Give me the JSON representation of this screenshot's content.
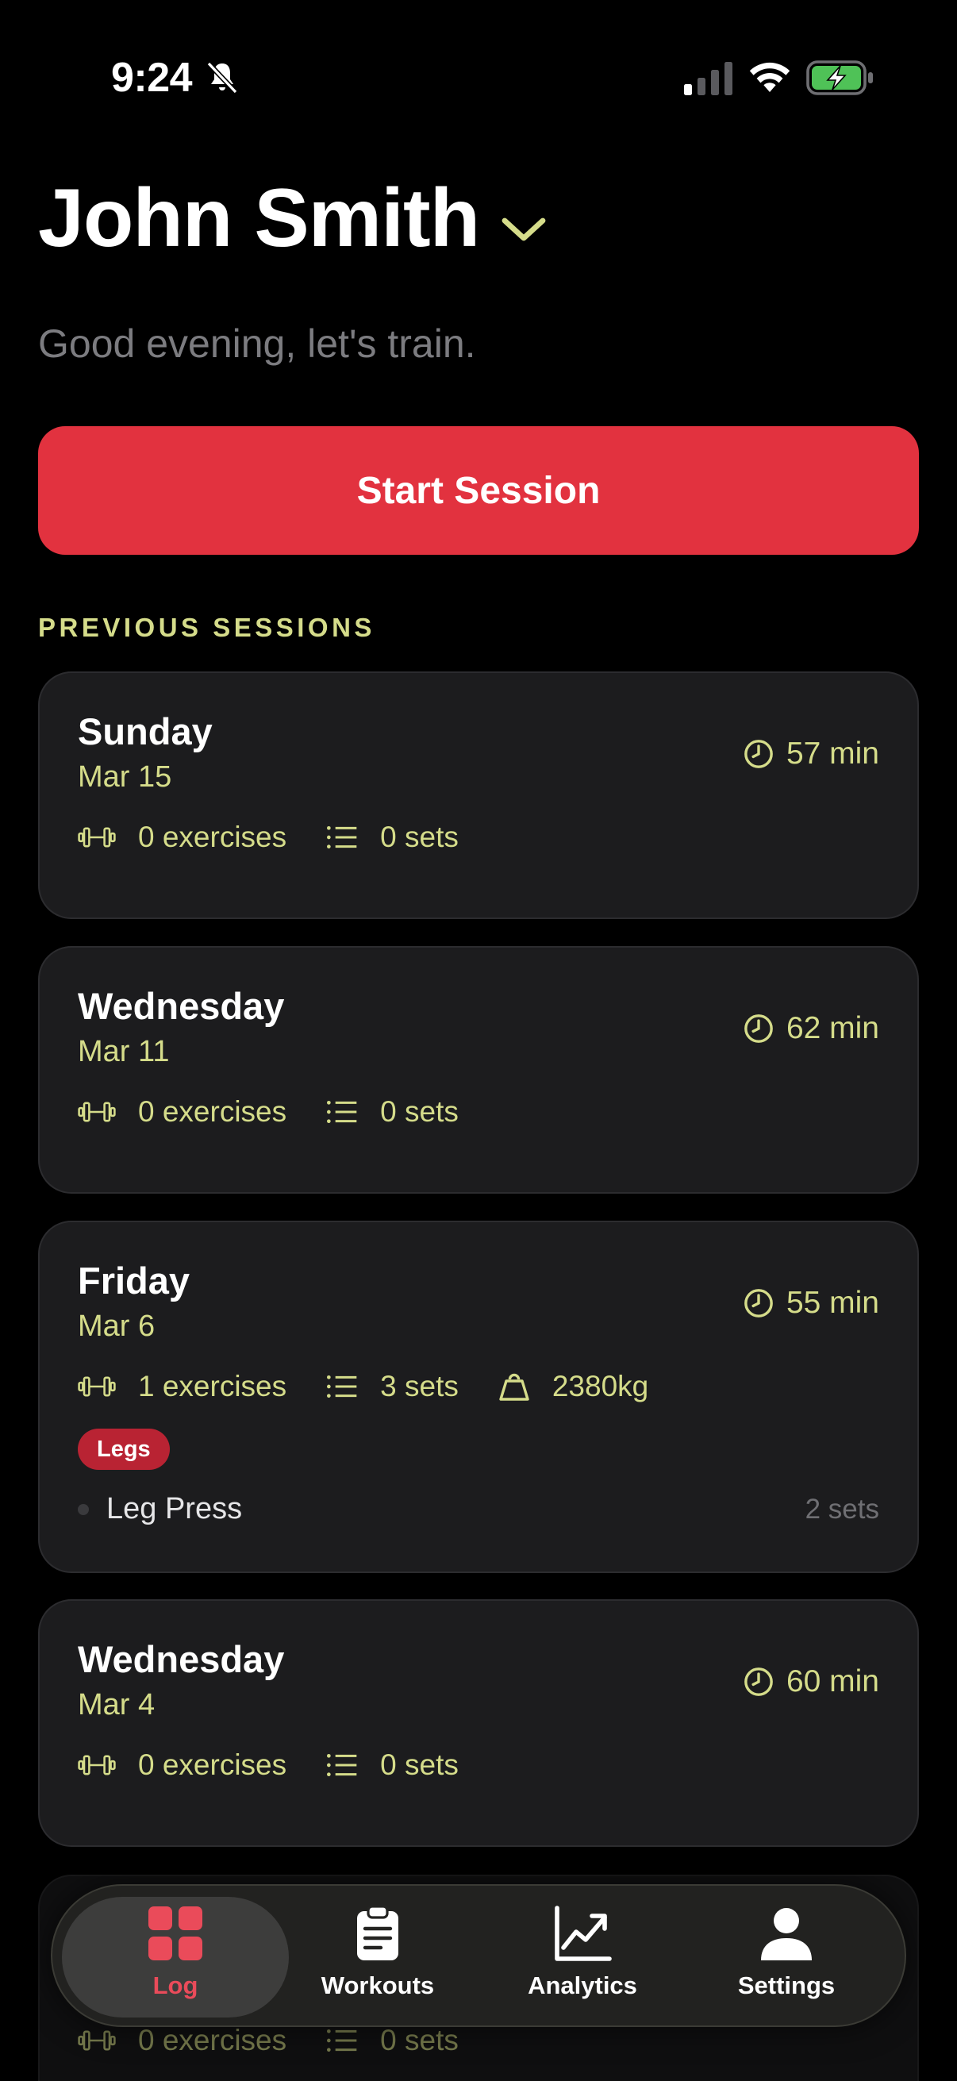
{
  "status_bar": {
    "time": "9:24"
  },
  "header": {
    "user_name": "John Smith",
    "greeting": "Good evening, let's train."
  },
  "start_button_label": "Start Session",
  "section_label": "PREVIOUS SESSIONS",
  "sessions": [
    {
      "day": "Sunday",
      "date": "Mar 15",
      "duration": "57 min",
      "exercises": "0 exercises",
      "sets": "0 sets"
    },
    {
      "day": "Wednesday",
      "date": "Mar 11",
      "duration": "62 min",
      "exercises": "0 exercises",
      "sets": "0 sets"
    },
    {
      "day": "Friday",
      "date": "Mar 6",
      "duration": "55 min",
      "exercises": "1 exercises",
      "sets": "3 sets",
      "volume": "2380kg",
      "tag": "Legs",
      "exercise_name": "Leg Press",
      "exercise_sets": "2 sets"
    },
    {
      "day": "Wednesday",
      "date": "Mar 4",
      "duration": "60 min",
      "exercises": "0 exercises",
      "sets": "0 sets"
    },
    {
      "exercises": "0 exercises",
      "sets": "0 sets"
    }
  ],
  "tabs": [
    {
      "label": "Log",
      "icon": "grid-icon",
      "active": true
    },
    {
      "label": "Workouts",
      "icon": "clipboard-icon"
    },
    {
      "label": "Analytics",
      "icon": "chart-icon"
    },
    {
      "label": "Settings",
      "icon": "person-icon"
    }
  ],
  "colors": {
    "accent": "#d5dc8a",
    "primary_button": "#e2323f",
    "active_tab": "#ea4b5a",
    "tag": "#b92333",
    "card": "#1c1c1e"
  }
}
